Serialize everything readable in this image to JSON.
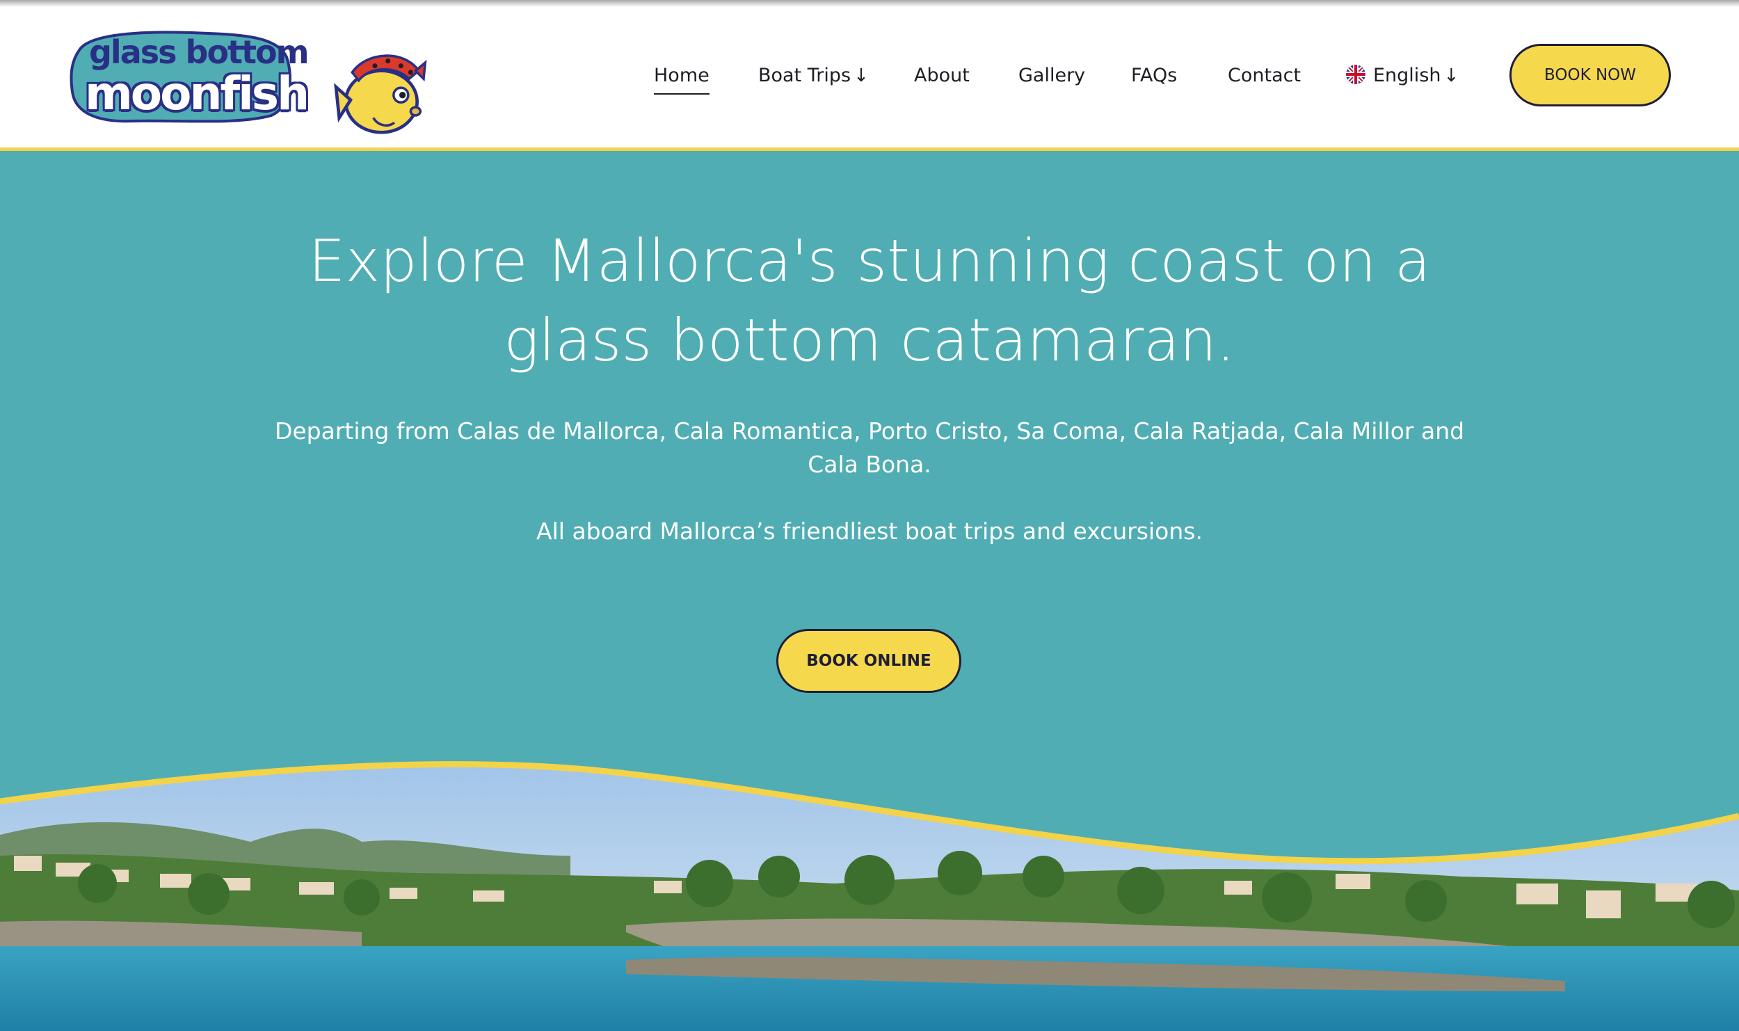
{
  "header": {
    "logo": {
      "line1": "glass bottom",
      "line2": "moonfish"
    },
    "nav": {
      "items": [
        {
          "label": "Home",
          "active": true
        },
        {
          "label": "Boat Trips",
          "dropdown": true
        },
        {
          "label": "About"
        },
        {
          "label": "Gallery"
        },
        {
          "label": "FAQs"
        },
        {
          "label": "Contact"
        }
      ],
      "language": {
        "label": "English",
        "icon": "uk-flag-icon"
      },
      "dropdown_icon": "↓"
    },
    "book_now_label": "BOOK NOW"
  },
  "hero": {
    "title_line1": "Explore Mallorca's stunning coast on a",
    "title_line2": "glass bottom catamaran.",
    "subtitle_line1": "Departing from Calas de Mallorca, Cala Romantica, Porto Cristo, Sa Coma, Cala Ratjada, Cala Millor and",
    "subtitle_line2": "Cala Bona.",
    "tagline": "All aboard Mallorca’s friendliest boat trips and excursions.",
    "cta_label": "BOOK ONLINE"
  },
  "colors": {
    "accent_yellow": "#f6d84d",
    "teal": "#4fadb3",
    "navy": "#1e1e3a"
  }
}
